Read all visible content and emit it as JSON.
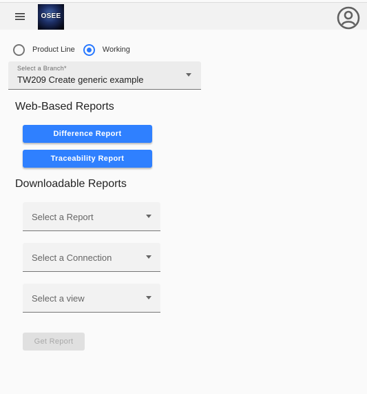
{
  "header": {
    "logo_text": "OSEE",
    "menu_icon": "hamburger-menu-icon",
    "account_icon": "account-circle-icon"
  },
  "mode": {
    "options": [
      {
        "label": "Product Line",
        "selected": false
      },
      {
        "label": "Working",
        "selected": true
      }
    ],
    "accent_color": "#2979ff"
  },
  "branch": {
    "label": "Select a Branch*",
    "value": "TW209 Create generic example"
  },
  "web_reports": {
    "heading": "Web-Based Reports",
    "buttons": [
      "Difference Report",
      "Traceability Report"
    ],
    "button_color": "#2f80ff"
  },
  "downloadable": {
    "heading": "Downloadable Reports",
    "report_placeholder": "Select a Report",
    "connection_placeholder": "Select a Connection",
    "view_placeholder": "Select a view",
    "get_report_label": "Get Report"
  }
}
